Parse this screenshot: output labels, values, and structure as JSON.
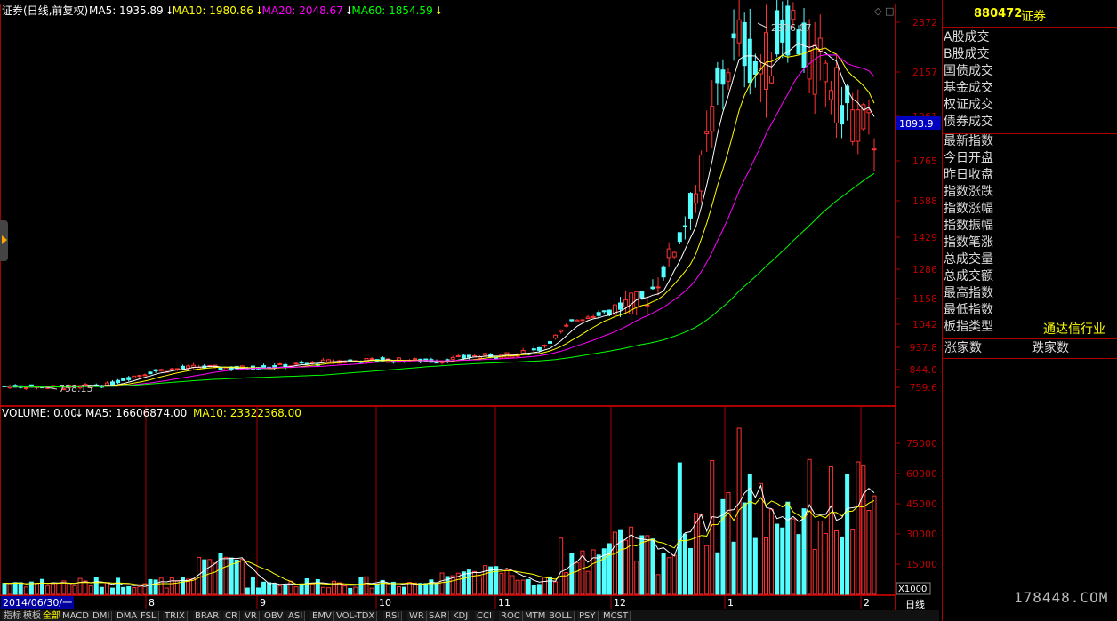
{
  "header": {
    "title": "证券(日线,前复权)",
    "ma_labels": [
      {
        "text": "MA5: 1935.89",
        "color": "#ffffff"
      },
      {
        "text": "MA10: 1980.86",
        "color": "#ffff00"
      },
      {
        "text": "MA20: 2048.67",
        "color": "#ff00ff"
      },
      {
        "text": "MA60: 1854.59",
        "color": "#00ff00"
      }
    ],
    "price_tag": "1893.9"
  },
  "volume_header": {
    "title": "VOLUME: 0.00",
    "ma5": "MA5: 16606874.00",
    "ma10": "MA10: 23322368.00"
  },
  "side_panel": {
    "code": "880472",
    "name": "证券",
    "rows1": [
      "A股成交",
      "B股成交",
      "国债成交",
      "基金成交",
      "权证成交",
      "债券成交"
    ],
    "rows2": [
      "最新指数",
      "今日开盘",
      "昨日收盘",
      "指数涨跌",
      "指数涨幅",
      "指数振幅",
      "指数笔涨",
      "总成交量",
      "总成交额",
      "最高指数",
      "最低指数",
      "板指类型"
    ],
    "industry": "通达信行业",
    "up_label": "涨家数",
    "down_label": "跌家数"
  },
  "bottom": {
    "date_label": "2014/06/30/一",
    "x1000": "X1000",
    "period": "日线",
    "tabs": [
      "指标",
      "模板",
      "全部",
      "MACD",
      "DMI",
      "DMA",
      "FSL",
      "TRIX",
      "BRAR",
      "CR",
      "VR",
      "OBV",
      "ASI",
      "EMV",
      "VOL-TDX",
      "RSI",
      "WR",
      "SAR",
      "KDJ",
      "CCI",
      "ROC",
      "MTM",
      "BOLL",
      "PSY",
      "MCST"
    ],
    "watermark": "178448.COM"
  },
  "chart_data": [
    {
      "type": "candlestick",
      "title": "证券(日线,前复权)",
      "y_ticks": [
        2372,
        2157,
        1961,
        1765,
        1588,
        1429,
        1286,
        1158,
        1042,
        937.8,
        844.0,
        759.6
      ],
      "ylim": [
        720,
        2400
      ],
      "x_month_labels": [
        "8",
        "9",
        "10",
        "11",
        "12",
        "1",
        "2"
      ],
      "annotations": [
        {
          "text": "2376.07",
          "kind": "high"
        },
        {
          "text": "758.15",
          "kind": "low"
        }
      ],
      "series": [
        {
          "name": "MA5",
          "color": "#ffffff"
        },
        {
          "name": "MA10",
          "color": "#ffff00"
        },
        {
          "name": "MA20",
          "color": "#ff00ff"
        },
        {
          "name": "MA60",
          "color": "#00ff00"
        }
      ]
    },
    {
      "type": "bar",
      "title": "VOLUME",
      "y_ticks": [
        75000,
        60000,
        45000,
        30000,
        15000
      ],
      "unit": "X1000",
      "ylim": [
        0,
        90000
      ]
    }
  ]
}
